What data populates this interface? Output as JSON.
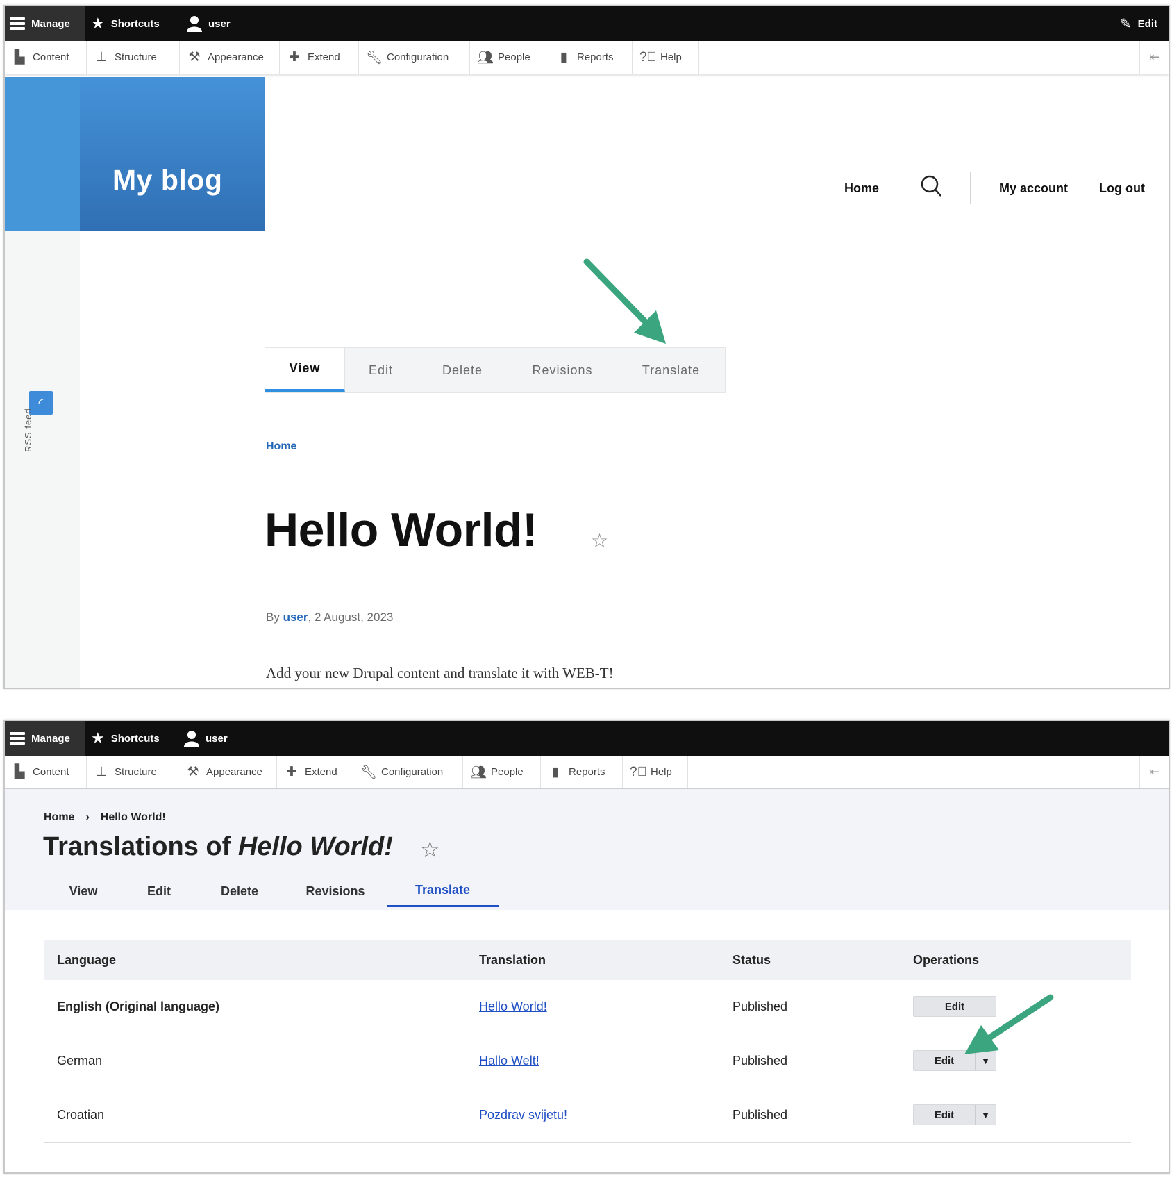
{
  "toolbar": {
    "manage": "Manage",
    "shortcuts": "Shortcuts",
    "user": "user",
    "edit": "Edit"
  },
  "tray": {
    "items": [
      {
        "label": "Content",
        "icon": "document-icon"
      },
      {
        "label": "Structure",
        "icon": "sitemap-icon"
      },
      {
        "label": "Appearance",
        "icon": "paintbrush-icon"
      },
      {
        "label": "Extend",
        "icon": "puzzle-icon"
      },
      {
        "label": "Configuration",
        "icon": "wrench-icon"
      },
      {
        "label": "People",
        "icon": "people-icon"
      },
      {
        "label": "Reports",
        "icon": "bar-chart-icon"
      },
      {
        "label": "Help",
        "icon": "help-icon"
      }
    ]
  },
  "site": {
    "logo": "My blog",
    "rss": "RSS feed",
    "nav": {
      "home": "Home",
      "account": "My account",
      "logout": "Log out"
    }
  },
  "node": {
    "tabs": [
      "View",
      "Edit",
      "Delete",
      "Revisions",
      "Translate"
    ],
    "active_tab": "View",
    "breadcrumb": "Home",
    "title": "Hello World!",
    "by": "By",
    "author": "user",
    "date": ", 2 August, 2023",
    "body": "Add your new Drupal content and translate it with WEB-T!"
  },
  "translations": {
    "breadcrumb": [
      "Home",
      "Hello World!"
    ],
    "breadcrumb_sep": "›",
    "title_prefix": "Translations of",
    "title_node": "Hello World!",
    "tabs": [
      "View",
      "Edit",
      "Delete",
      "Revisions",
      "Translate"
    ],
    "active_tab": "Translate",
    "columns": [
      "Language",
      "Translation",
      "Status",
      "Operations"
    ],
    "rows": [
      {
        "language": "English (Original language)",
        "translation": "Hello World!",
        "status": "Published",
        "operation": "Edit"
      },
      {
        "language": "German",
        "translation": "Hallo Welt!",
        "status": "Published",
        "operation": "Edit"
      },
      {
        "language": "Croatian",
        "translation": "Pozdrav svijetu!",
        "status": "Published",
        "operation": "Edit"
      }
    ]
  },
  "colors": {
    "accent_blue": "#2f8fe0",
    "link_blue": "#1f4fc4",
    "arrow_green": "#3aa57f"
  }
}
